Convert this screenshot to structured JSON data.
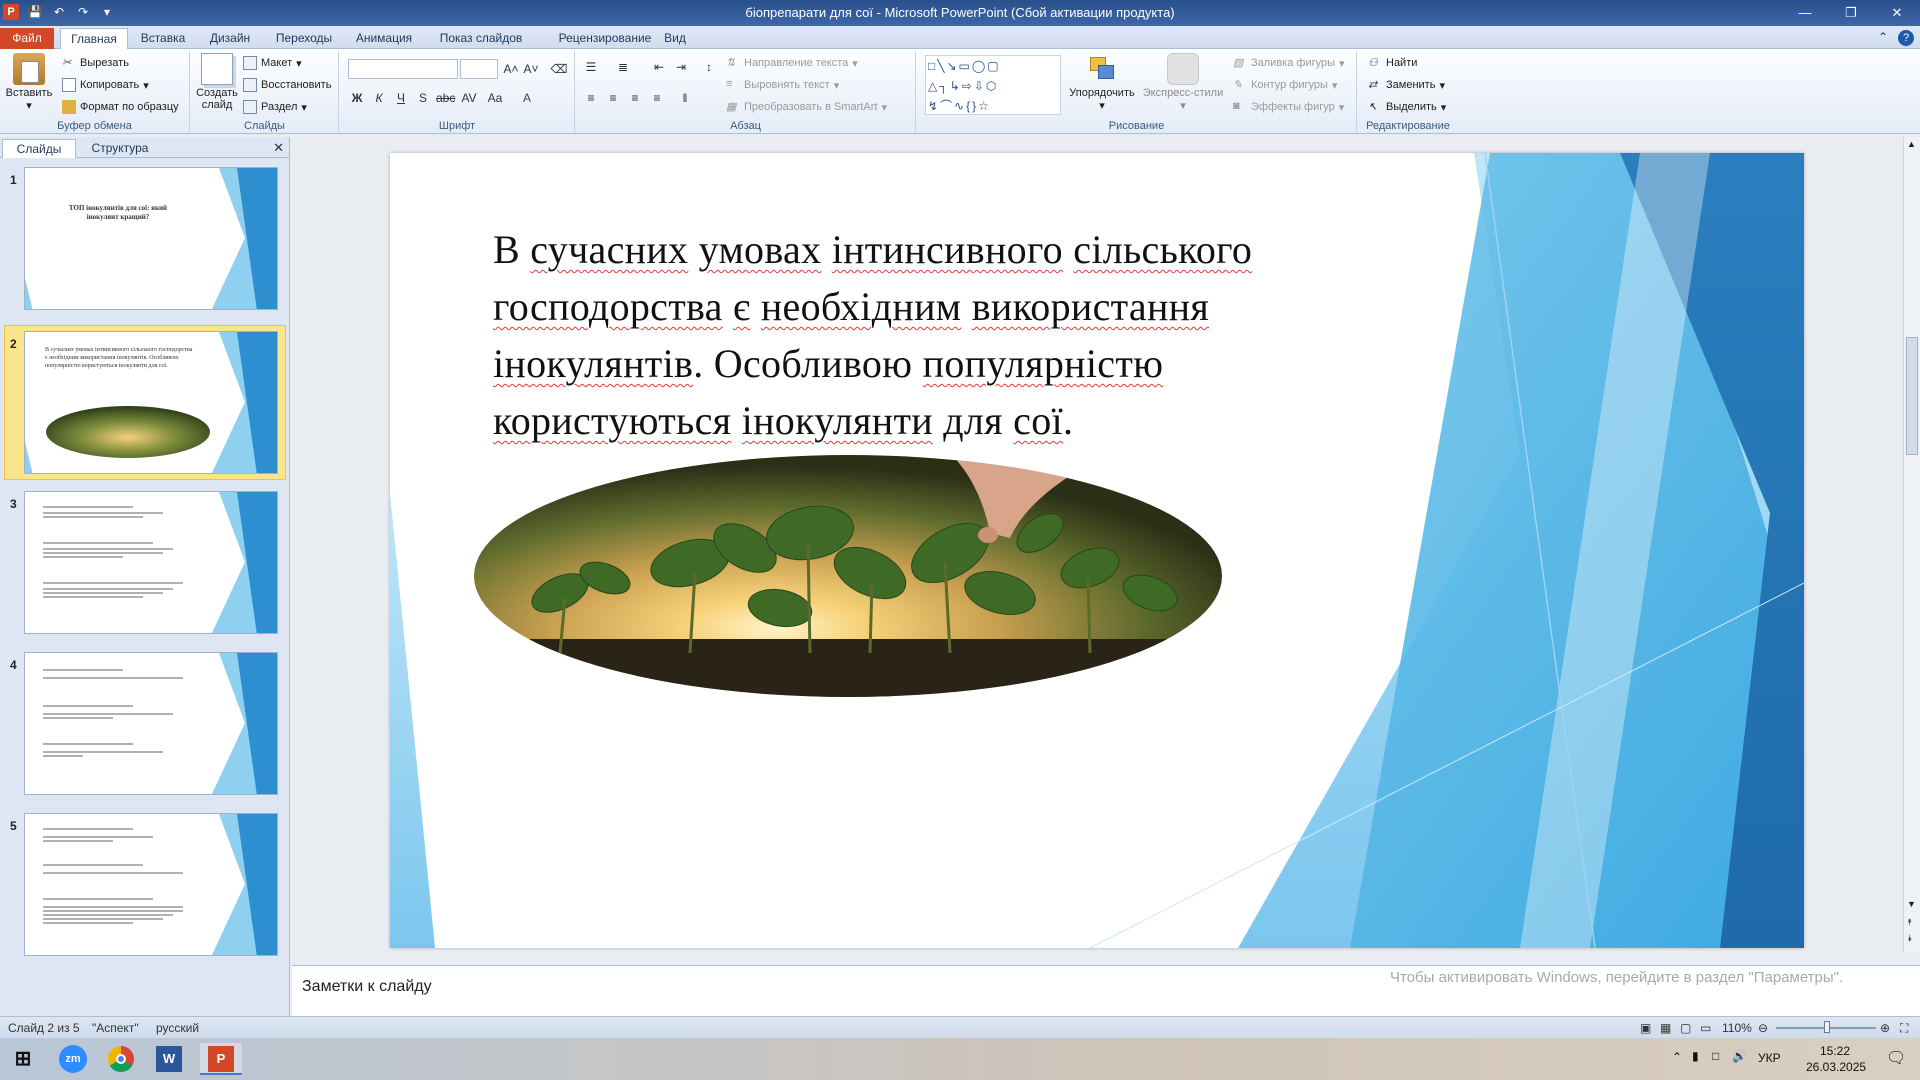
{
  "window": {
    "title": "біопрепарати для сої  -  Microsoft PowerPoint (Сбой активации продукта)",
    "app_icon": "P"
  },
  "ribbon_tabs": [
    "Файл",
    "Главная",
    "Вставка",
    "Дизайн",
    "Переходы",
    "Анимация",
    "Показ слайдов",
    "Рецензирование",
    "Вид"
  ],
  "ribbon": {
    "clipboard": {
      "paste": "Вставить",
      "cut": "Вырезать",
      "copy": "Копировать",
      "format_painter": "Формат по образцу",
      "label": "Буфер обмена"
    },
    "slides": {
      "new_slide": "Создать слайд",
      "layout": "Макет",
      "reset": "Восстановить",
      "section": "Раздел",
      "label": "Слайды"
    },
    "font": {
      "label": "Шрифт"
    },
    "paragraph": {
      "text_direction": "Направление текста",
      "align_text": "Выровнять текст",
      "smartart": "Преобразовать в SmartArt",
      "label": "Абзац"
    },
    "drawing": {
      "arrange": "Упорядочить",
      "quick_styles": "Экспресс-стили",
      "fill": "Заливка фигуры",
      "outline": "Контур фигуры",
      "effects": "Эффекты фигур",
      "label": "Рисование"
    },
    "editing": {
      "find": "Найти",
      "replace": "Заменить",
      "select": "Выделить",
      "label": "Редактирование"
    }
  },
  "panel": {
    "tab_slides": "Слайды",
    "tab_outline": "Структура"
  },
  "thumbnails": [
    {
      "num": "1",
      "text": "ТОП інокулянтів  для  сої: який інокулянт  кращий?"
    },
    {
      "num": "2",
      "text": "В сучасних умовах інтинсивного сільського господорства є необхідним використання інокулянтів. Особливою популярністю користуються інокулянти для сої."
    },
    {
      "num": "3",
      "text": ""
    },
    {
      "num": "4",
      "text": ""
    },
    {
      "num": "5",
      "text": ""
    }
  ],
  "slide": {
    "lines": [
      [
        {
          "t": "В ",
          "u": false
        },
        {
          "t": "сучасних",
          "u": true
        },
        {
          "t": " ",
          "u": false
        },
        {
          "t": "умовах",
          "u": true
        },
        {
          "t": " ",
          "u": false
        },
        {
          "t": "інтинсивного",
          "u": true
        },
        {
          "t": " ",
          "u": false
        },
        {
          "t": "сільського",
          "u": true
        }
      ],
      [
        {
          "t": "господорства",
          "u": true
        },
        {
          "t": " ",
          "u": false
        },
        {
          "t": "є",
          "u": true
        },
        {
          "t": " ",
          "u": false
        },
        {
          "t": "необхідним",
          "u": true
        },
        {
          "t": " ",
          "u": false
        },
        {
          "t": "використання",
          "u": true
        }
      ],
      [
        {
          "t": "інокулянтів",
          "u": true
        },
        {
          "t": ".  Особливою ",
          "u": false
        },
        {
          "t": "популярністю",
          "u": true
        }
      ],
      [
        {
          "t": "користуються",
          "u": true
        },
        {
          "t": " ",
          "u": false
        },
        {
          "t": "інокулянти",
          "u": true
        },
        {
          "t": "  для ",
          "u": false
        },
        {
          "t": "сої",
          "u": true
        },
        {
          "t": ".",
          "u": false
        }
      ]
    ]
  },
  "notes_placeholder": "Заметки к слайду",
  "activation_watermark": "Чтобы активировать Windows, перейдите в раздел \"Параметры\".",
  "status": {
    "slide": "Слайд 2 из 5",
    "theme": "\"Аспект\"",
    "language": "русский",
    "zoom": "110%"
  },
  "tray": {
    "lang": "УКР",
    "time": "15:22",
    "date": "26.03.2025"
  },
  "colors": {
    "accent_blue": "#2e8fd0",
    "light_blue": "#8fd0f0",
    "file_tab": "#d24726"
  }
}
